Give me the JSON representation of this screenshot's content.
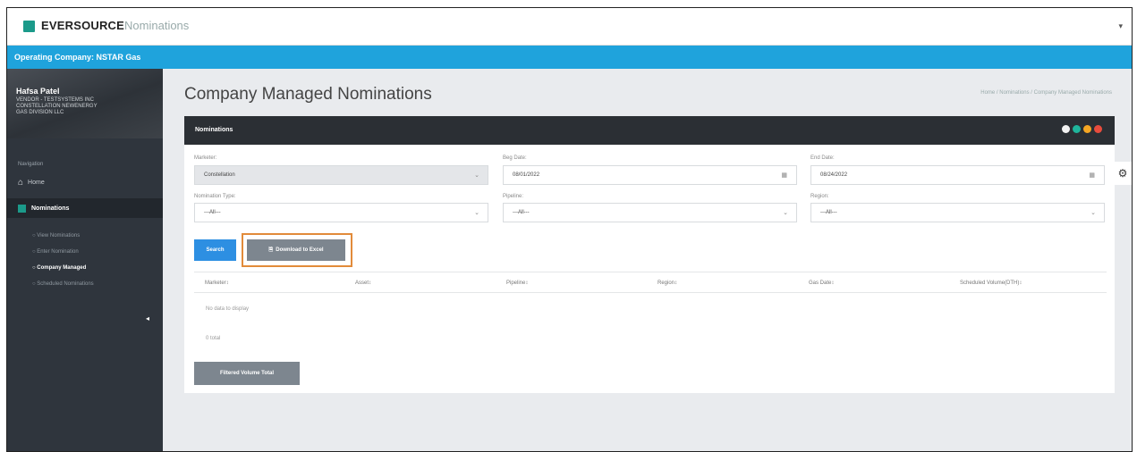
{
  "header": {
    "brand_bold": "EVERSOURCE",
    "brand_light": "Nominations",
    "menu_caret": "▾"
  },
  "op_bar": {
    "label": "Operating Company: NSTAR Gas"
  },
  "sidebar": {
    "user_name": "Hafsa Patel",
    "user_line1": "VENDOR - TESTSYSTEMS INC",
    "user_line2": "CONSTELLATION NEWENERGY",
    "user_line3": "GAS DIVISION LLC",
    "nav_heading": "Navigation",
    "home_label": "Home",
    "nominations_label": "Nominations",
    "sub_items": [
      "View Nominations",
      "Enter Nomination",
      "Company Managed",
      "Scheduled Nominations"
    ],
    "active_sub_item": "Company Managed",
    "collapse_glyph": "◂"
  },
  "page": {
    "title": "Company Managed Nominations",
    "breadcrumb": "Home  /  Nominations  /  Company Managed Nominations"
  },
  "panel": {
    "title": "Nominations",
    "header_dots": [
      "#f2f2f2",
      "#1fb59b",
      "#f5a623",
      "#e84c3d"
    ]
  },
  "filters": {
    "marketer_label": "Marketer:",
    "marketer_value": "Constellation",
    "beg_date_label": "Beg Date:",
    "beg_date_value": "08/01/2022",
    "end_date_label": "End Date:",
    "end_date_value": "08/24/2022",
    "nomination_type_label": "Nomination Type:",
    "nomination_type_value": "---All---",
    "pipeline_label": "Pipeline:",
    "pipeline_value": "---All---",
    "region_label": "Region:",
    "region_value": "---All---"
  },
  "actions": {
    "search_label": "Search",
    "download_label": "Download to Excel",
    "filtered_total_label": "Filtered Volume Total"
  },
  "table": {
    "headers": [
      "Marketer↕",
      "Asset↕",
      "Pipeline↕",
      "Region↕",
      "Gas Date↕",
      "Scheduled Volume(DTH)↕"
    ],
    "empty_message": "No data to display",
    "total_text": "0 total"
  },
  "icons": {
    "chevron": "⌄",
    "calendar": "▦",
    "file": "🗎",
    "home": "⌂",
    "gear": "⚙"
  }
}
